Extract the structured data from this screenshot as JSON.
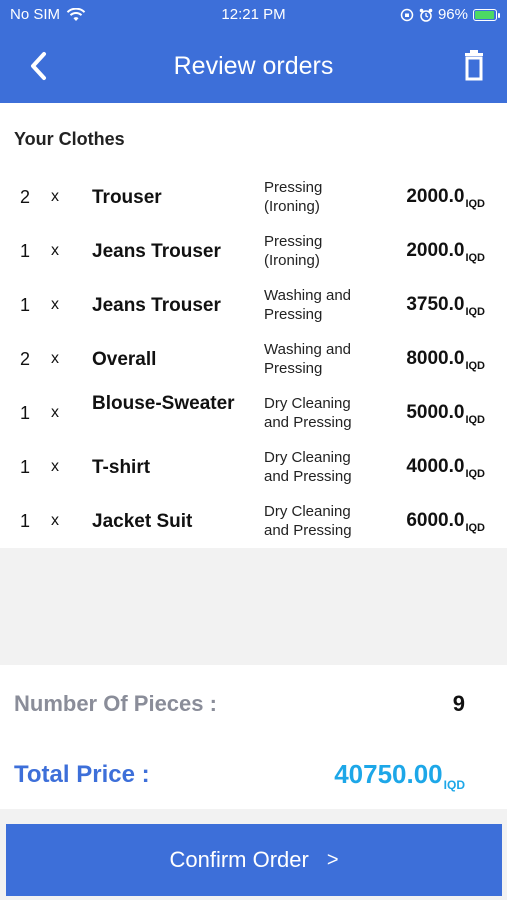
{
  "status_bar": {
    "carrier": "No SIM",
    "time": "12:21 PM",
    "battery": "96%",
    "battery_level": 0.96
  },
  "header": {
    "title": "Review orders",
    "back_icon": "chevron-left-icon",
    "delete_icon": "trash-icon"
  },
  "section_title": "Your Clothes",
  "items": [
    {
      "qty": "2",
      "x": "x",
      "name": "Trouser",
      "service": "Pressing (Ironing)",
      "price": "2000.0",
      "currency": "IQD"
    },
    {
      "qty": "1",
      "x": "x",
      "name": "Jeans Trouser",
      "service": "Pressing (Ironing)",
      "price": "2000.0",
      "currency": "IQD"
    },
    {
      "qty": "1",
      "x": "x",
      "name": "Jeans Trouser",
      "service": "Washing and Pressing",
      "price": "3750.0",
      "currency": "IQD"
    },
    {
      "qty": "2",
      "x": "x",
      "name": "Overall",
      "service": "Washing and Pressing",
      "price": "8000.0",
      "currency": "IQD"
    },
    {
      "qty": "1",
      "x": "x",
      "name": "Blouse-Sweater",
      "service": "Dry Cleaning and Pressing",
      "price": "5000.0",
      "currency": "IQD"
    },
    {
      "qty": "1",
      "x": "x",
      "name": "T-shirt",
      "service": "Dry Cleaning and Pressing",
      "price": "4000.0",
      "currency": "IQD"
    },
    {
      "qty": "1",
      "x": "x",
      "name": "Jacket Suit",
      "service": "Dry Cleaning and Pressing",
      "price": "6000.0",
      "currency": "IQD"
    }
  ],
  "summary": {
    "pieces_label": "Number Of Pieces :",
    "pieces_value": "9",
    "total_label": "Total Price :",
    "total_value": "40750.00",
    "total_currency": "IQD"
  },
  "confirm_button": {
    "label": "Confirm Order",
    "chevron": ">"
  },
  "colors": {
    "primary": "#3d6fd9",
    "total": "#1da7e8",
    "muted": "#8a8d99"
  }
}
